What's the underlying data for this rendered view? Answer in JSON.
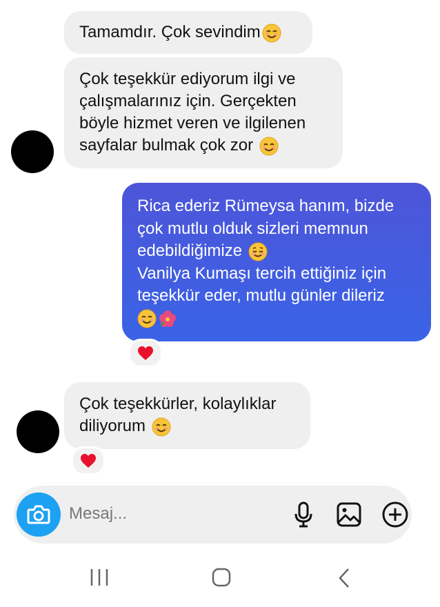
{
  "messages": [
    {
      "direction": "in",
      "lines": [
        "Tamamdır. Çok sevindim"
      ],
      "emoji": "smiling-face"
    },
    {
      "direction": "in",
      "lines": [
        "Çok teşekkür ediyorum ilgi ve",
        "çalışmalarınız için. Gerçekten",
        "böyle hizmet veren ve ilgilenen",
        "sayfalar bulmak çok zor"
      ],
      "emoji": "smiling-face"
    },
    {
      "direction": "out",
      "lines": [
        "Rica ederiz Rümeysa hanım, bizde",
        "çok mutlu olduk sizleri memnun",
        "edebildiğimize",
        "Vanilya Kumaşı tercih ettiğiniz için",
        "teşekkür eder, mutlu günler dileriz"
      ],
      "emojis": [
        "relieved-face",
        "smiling-face",
        "hibiscus"
      ],
      "reaction": "heart"
    },
    {
      "direction": "in",
      "lines": [
        "Çok teşekkürler, kolaylıklar",
        "diliyorum"
      ],
      "emoji": "smiling-face",
      "reaction": "heart"
    }
  ],
  "composer": {
    "placeholder": "Mesaj...",
    "icons": [
      "camera-icon",
      "microphone-icon",
      "gallery-icon",
      "add-icon"
    ]
  },
  "navbar": {
    "icons": [
      "recent-apps-icon",
      "home-icon",
      "back-icon"
    ]
  },
  "colors": {
    "outgoing_bubble": "#4a57dc",
    "incoming_bubble": "#efefef",
    "camera_button": "#1da1f2",
    "heart": "#e8112d"
  }
}
